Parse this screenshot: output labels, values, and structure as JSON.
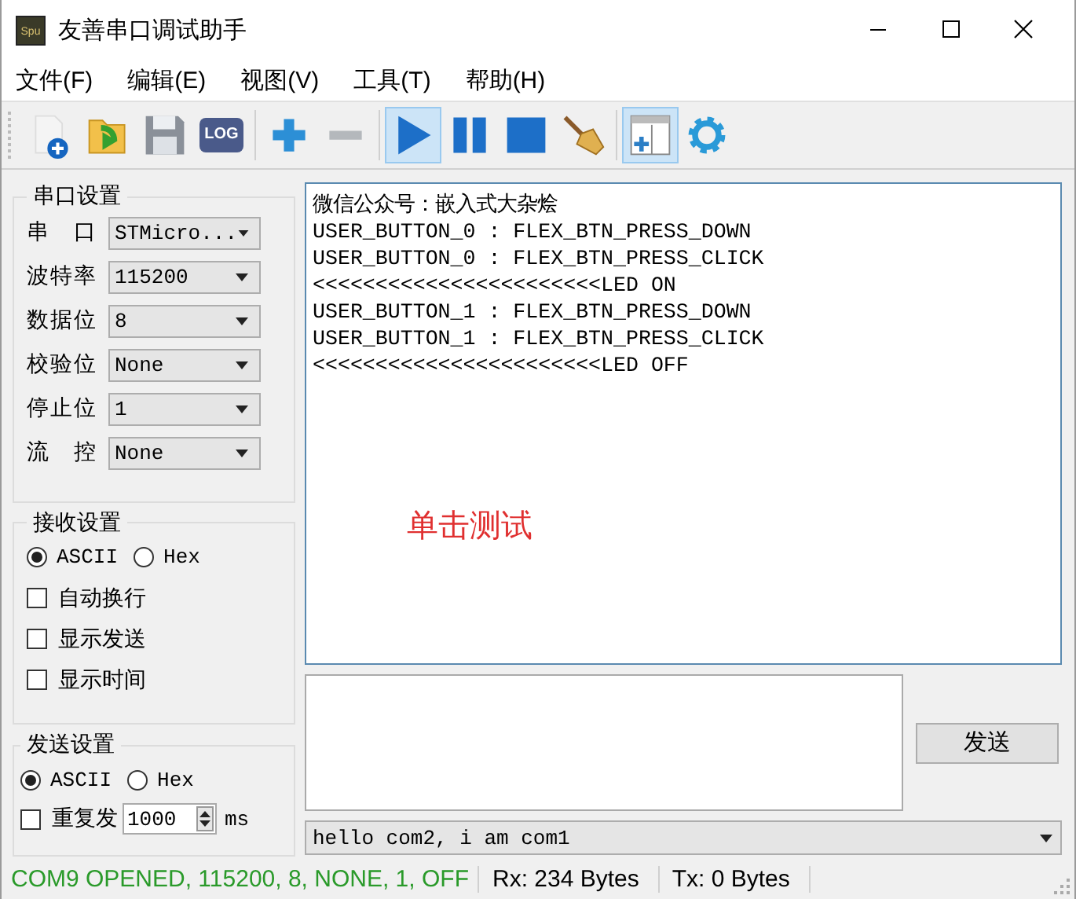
{
  "window": {
    "title": "友善串口调试助手",
    "logo_text": "Spu"
  },
  "menu": [
    "文件(F)",
    "编辑(E)",
    "视图(V)",
    "工具(T)",
    "帮助(H)"
  ],
  "toolbar": [
    [
      {
        "kind": "new",
        "pressed": false
      },
      {
        "kind": "open",
        "pressed": false
      },
      {
        "kind": "save",
        "pressed": false
      },
      {
        "kind": "log",
        "label": "LOG",
        "pressed": false
      }
    ],
    [
      {
        "kind": "add",
        "pressed": false
      },
      {
        "kind": "remove",
        "pressed": false
      }
    ],
    [
      {
        "kind": "start",
        "pressed": true
      },
      {
        "kind": "pause",
        "pressed": false
      },
      {
        "kind": "stop",
        "pressed": false
      },
      {
        "kind": "clear",
        "pressed": false
      }
    ],
    [
      {
        "kind": "panel",
        "pressed": true
      },
      {
        "kind": "settings",
        "pressed": false
      }
    ]
  ],
  "serial_settings": {
    "title": "串口设置",
    "fields": [
      {
        "label": "串 口",
        "value": "STMicro..."
      },
      {
        "label": "波特率",
        "value": "115200"
      },
      {
        "label": "数据位",
        "value": "8"
      },
      {
        "label": "校验位",
        "value": "None"
      },
      {
        "label": "停止位",
        "value": "1"
      },
      {
        "label": "流 控",
        "value": "None"
      }
    ]
  },
  "receive_settings": {
    "title": "接收设置",
    "radios": [
      {
        "label": "ASCII",
        "selected": true
      },
      {
        "label": "Hex",
        "selected": false
      }
    ],
    "checkboxes": [
      {
        "label": "自动换行",
        "checked": false
      },
      {
        "label": "显示发送",
        "checked": false
      },
      {
        "label": "显示时间",
        "checked": false
      }
    ]
  },
  "send_settings": {
    "title": "发送设置",
    "radios": [
      {
        "label": "ASCII",
        "selected": true
      },
      {
        "label": "Hex",
        "selected": false
      }
    ],
    "repeat": {
      "label": "重复发",
      "checked": false,
      "value": "1000",
      "unit": "ms"
    }
  },
  "receive_log": [
    "微信公众号：嵌入式大杂烩",
    "USER_BUTTON_0 : FLEX_BTN_PRESS_DOWN",
    "USER_BUTTON_0 : FLEX_BTN_PRESS_CLICK",
    "<<<<<<<<<<<<<<<<<<<<<<<LED ON",
    "USER_BUTTON_1 : FLEX_BTN_PRESS_DOWN",
    "USER_BUTTON_1 : FLEX_BTN_PRESS_CLICK",
    "<<<<<<<<<<<<<<<<<<<<<<<LED OFF"
  ],
  "annotation": "单击测试",
  "send_button": "发送",
  "history_value": "hello com2, i am com1",
  "status_bar": {
    "connection": "COM9 OPENED, 115200, 8, NONE, 1, OFF",
    "rx": "Rx: 234 Bytes",
    "tx": "Tx: 0 Bytes"
  }
}
